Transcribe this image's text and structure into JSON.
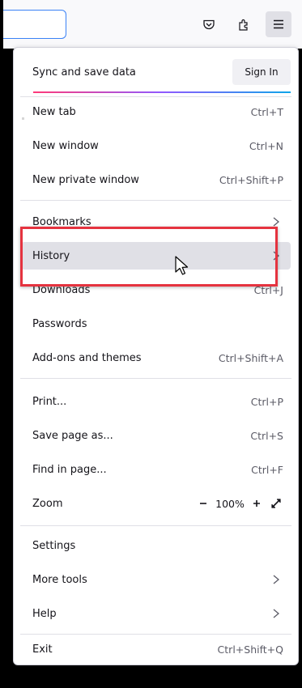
{
  "toolbar": {
    "pocket_icon": "pocket-icon",
    "extensions_icon": "extensions-icon",
    "menu_icon": "hamburger-menu-icon"
  },
  "menu": {
    "sync": {
      "label": "Sync and save data",
      "signin": "Sign In"
    },
    "items": [
      {
        "label": "New tab",
        "shortcut": "Ctrl+T"
      },
      {
        "label": "New window",
        "shortcut": "Ctrl+N"
      },
      {
        "label": "New private window",
        "shortcut": "Ctrl+Shift+P"
      },
      {
        "label": "Bookmarks"
      },
      {
        "label": "History"
      },
      {
        "label": "Downloads",
        "shortcut": "Ctrl+J"
      },
      {
        "label": "Passwords"
      },
      {
        "label": "Add-ons and themes",
        "shortcut": "Ctrl+Shift+A"
      },
      {
        "label": "Print...",
        "shortcut": "Ctrl+P"
      },
      {
        "label": "Save page as...",
        "shortcut": "Ctrl+S"
      },
      {
        "label": "Find in page...",
        "shortcut": "Ctrl+F"
      },
      {
        "label": "Settings"
      },
      {
        "label": "More tools"
      },
      {
        "label": "Help"
      },
      {
        "label": "Exit",
        "shortcut": "Ctrl+Shift+Q"
      }
    ],
    "zoom": {
      "label": "Zoom",
      "value": "100%",
      "minus": "−",
      "plus": "+"
    }
  },
  "colors": {
    "highlight_border": "#e5333f",
    "hover_bg": "#e0e0e6",
    "accent_start": "#ff3a79",
    "accent_mid": "#9059ff",
    "accent_end": "#0ea5e9"
  }
}
